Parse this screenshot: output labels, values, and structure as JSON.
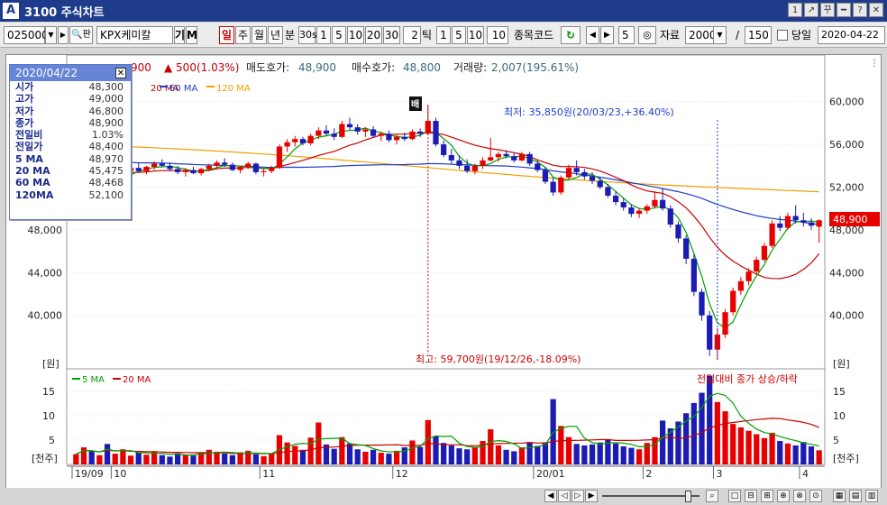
{
  "window": {
    "logo": "A",
    "title": "3100 주식차트",
    "buttons": [
      "1",
      "↗",
      "꾸",
      "━",
      "?",
      "✕"
    ]
  },
  "toolbar": {
    "stock_code": "025000",
    "search_label": "🔍",
    "search_suffix": "판",
    "stock_name": "KPX케미칼",
    "btn_gi": "기",
    "btn_m": "M",
    "period_tabs": [
      "일",
      "주",
      "월",
      "년",
      "분"
    ],
    "active_period": "일",
    "minute_options": [
      "30s",
      "1",
      "5",
      "10",
      "20",
      "30"
    ],
    "tick_value": "2",
    "tick_label": "틱",
    "tick_options": [
      "1",
      "5",
      "10"
    ],
    "tick_input": "10",
    "code_label": "종목코드",
    "count_value": "5",
    "data_label": "자료",
    "data_count": "2000",
    "separator": "/",
    "view_count": "150",
    "today_label": "당일",
    "date_value": "2020-04-22"
  },
  "chart_header": {
    "price_partial": "900",
    "change": "▲ 500(1.03%)",
    "ask_label": "매도호가:",
    "ask_value": "48,900",
    "bid_label": "매수호가:",
    "bid_value": "48,800",
    "volume_label": "거래량:",
    "volume_value": "2,007(195.61%)"
  },
  "legend": {
    "ma5": "5 MA",
    "ma20": "20 MA",
    "ma60": "60 MA",
    "ma120": "120 MA"
  },
  "colors": {
    "up": "#e60000",
    "down": "#1c1cb4",
    "ma5": "#00a000",
    "ma20": "#c80000",
    "ma60": "#1e3cc8",
    "ma120": "#f0a000",
    "title_bg": "#1f3c8c",
    "last_price_bg": "#e60000"
  },
  "info_box": {
    "date": "2020/04/22",
    "close_icon": "✕",
    "rows": [
      {
        "k": "시가",
        "v": "48,300"
      },
      {
        "k": "고가",
        "v": "49,000"
      },
      {
        "k": "저가",
        "v": "46,800"
      },
      {
        "k": "종가",
        "v": "48,900"
      },
      {
        "k": "전일비",
        "v": "1.03%"
      },
      {
        "k": "전일가",
        "v": "48,400"
      },
      {
        "k": "5  MA",
        "v": "48,970"
      },
      {
        "k": "20 MA",
        "v": "45,475"
      },
      {
        "k": "60 MA",
        "v": "48,468"
      },
      {
        "k": "120MA",
        "v": "52,100"
      }
    ]
  },
  "annotations": {
    "low": "최저: 35,850원(20/03/23,+36.40%)",
    "high": "최고: 59,700원(19/12/26,-18.09%)",
    "marker_label": "배",
    "volume_legend": "전일대비 종가 상승/하락",
    "last_price": "48,900"
  },
  "chart_data": {
    "type": "candlestick",
    "y_unit": "[원]",
    "volume_unit": "[천주]",
    "price_axis_ticks": [
      "60,000",
      "56,000",
      "52,000",
      "48,000",
      "44,000",
      "40,000"
    ],
    "price_axis_values": [
      60000,
      56000,
      52000,
      48000,
      44000,
      40000
    ],
    "volume_axis_ticks": [
      "15",
      "10",
      "5"
    ],
    "volume_axis_values": [
      15,
      10,
      5
    ],
    "x_labels": [
      "19/09",
      "10",
      "11",
      "12",
      "20/01",
      "2",
      "3",
      "4"
    ],
    "ylim": [
      35000,
      62000
    ],
    "candles": [
      [
        53500,
        54200,
        53000,
        53800
      ],
      [
        53800,
        54500,
        53400,
        54100
      ],
      [
        54100,
        54300,
        52800,
        53000
      ],
      [
        53000,
        53600,
        52500,
        53400
      ],
      [
        53400,
        53700,
        52000,
        52200
      ],
      [
        52200,
        53300,
        52000,
        53100
      ],
      [
        53100,
        53800,
        52800,
        53500
      ],
      [
        53500,
        54000,
        53100,
        53800
      ],
      [
        53800,
        54300,
        53400,
        53500
      ],
      [
        53500,
        54000,
        53200,
        53900
      ],
      [
        53900,
        54400,
        53600,
        54200
      ],
      [
        54200,
        54600,
        53900,
        54000
      ],
      [
        54000,
        54300,
        53500,
        53700
      ],
      [
        53700,
        54000,
        53200,
        53400
      ],
      [
        53400,
        53800,
        53000,
        53600
      ],
      [
        53600,
        53900,
        53200,
        53300
      ],
      [
        53300,
        53800,
        53100,
        53700
      ],
      [
        53700,
        54200,
        53500,
        54000
      ],
      [
        54000,
        54500,
        53700,
        54300
      ],
      [
        54300,
        54700,
        53900,
        54100
      ],
      [
        54100,
        54300,
        53500,
        53600
      ],
      [
        53600,
        54000,
        53300,
        53900
      ],
      [
        53900,
        54400,
        53700,
        54200
      ],
      [
        54200,
        54300,
        53200,
        53400
      ],
      [
        53400,
        53700,
        53000,
        53500
      ],
      [
        53500,
        54000,
        53300,
        53800
      ],
      [
        53800,
        56000,
        53700,
        55800
      ],
      [
        55800,
        56500,
        55300,
        56200
      ],
      [
        56200,
        56800,
        55800,
        56500
      ],
      [
        56500,
        56700,
        55900,
        56100
      ],
      [
        56100,
        57000,
        55900,
        56800
      ],
      [
        56800,
        57600,
        56500,
        57300
      ],
      [
        57300,
        57800,
        56800,
        57000
      ],
      [
        57000,
        57500,
        56400,
        56700
      ],
      [
        56700,
        58200,
        56600,
        57900
      ],
      [
        57900,
        58500,
        57300,
        57600
      ],
      [
        57600,
        57900,
        56900,
        57200
      ],
      [
        57200,
        57600,
        56700,
        57400
      ],
      [
        57400,
        57700,
        56600,
        56800
      ],
      [
        56800,
        57200,
        56300,
        57000
      ],
      [
        57000,
        57300,
        56200,
        56400
      ],
      [
        56400,
        56900,
        56000,
        56700
      ],
      [
        56700,
        57100,
        56300,
        56500
      ],
      [
        56500,
        57400,
        56400,
        57200
      ],
      [
        57200,
        57500,
        56700,
        57000
      ],
      [
        57000,
        59700,
        56900,
        58200
      ],
      [
        58200,
        58500,
        55800,
        56000
      ],
      [
        56000,
        56400,
        54800,
        55000
      ],
      [
        55000,
        55600,
        54200,
        54500
      ],
      [
        54500,
        55000,
        53700,
        54000
      ],
      [
        54000,
        54600,
        53300,
        53500
      ],
      [
        53500,
        54200,
        53200,
        54000
      ],
      [
        54000,
        54800,
        53700,
        54500
      ],
      [
        54500,
        56600,
        54400,
        54800
      ],
      [
        54800,
        55300,
        54400,
        55100
      ],
      [
        55100,
        55400,
        54700,
        54900
      ],
      [
        54900,
        55200,
        54300,
        54500
      ],
      [
        54500,
        55300,
        54400,
        55100
      ],
      [
        55100,
        55300,
        54000,
        54200
      ],
      [
        54200,
        54500,
        53400,
        53600
      ],
      [
        53600,
        53900,
        52300,
        52500
      ],
      [
        52500,
        52900,
        51200,
        51500
      ],
      [
        51500,
        53100,
        51300,
        52900
      ],
      [
        52900,
        54100,
        52700,
        53800
      ],
      [
        53800,
        54500,
        53100,
        53400
      ],
      [
        53400,
        53700,
        52700,
        53000
      ],
      [
        53000,
        53400,
        52300,
        52600
      ],
      [
        52600,
        52900,
        51800,
        52000
      ],
      [
        52000,
        52300,
        51000,
        51200
      ],
      [
        51200,
        51600,
        50300,
        50600
      ],
      [
        50600,
        51000,
        49800,
        50100
      ],
      [
        50100,
        50400,
        49200,
        49500
      ],
      [
        49500,
        50000,
        49100,
        49800
      ],
      [
        49800,
        50400,
        49500,
        50200
      ],
      [
        50200,
        51600,
        50000,
        50800
      ],
      [
        50800,
        51900,
        49800,
        50000
      ],
      [
        50000,
        50300,
        48200,
        48500
      ],
      [
        48500,
        48800,
        46800,
        47200
      ],
      [
        47200,
        47500,
        44800,
        45300
      ],
      [
        45300,
        45700,
        41800,
        42200
      ],
      [
        42200,
        42500,
        39500,
        40000
      ],
      [
        40000,
        40400,
        36200,
        36800
      ],
      [
        36800,
        38800,
        35850,
        38200
      ],
      [
        38200,
        40600,
        37900,
        40300
      ],
      [
        40300,
        42600,
        40000,
        42300
      ],
      [
        42300,
        43600,
        41900,
        43200
      ],
      [
        43200,
        44400,
        42800,
        44100
      ],
      [
        44100,
        45500,
        43800,
        45200
      ],
      [
        45200,
        46800,
        45000,
        46500
      ],
      [
        46500,
        48900,
        46300,
        48600
      ],
      [
        48600,
        49300,
        47900,
        48200
      ],
      [
        48200,
        49600,
        48000,
        49300
      ],
      [
        49300,
        50300,
        48600,
        48900
      ],
      [
        48900,
        49600,
        48300,
        48700
      ],
      [
        48700,
        49100,
        48000,
        48400
      ],
      [
        48300,
        49000,
        46800,
        48900
      ]
    ],
    "volumes": [
      2.1,
      3.5,
      2.8,
      1.9,
      4.2,
      2.2,
      3.1,
      1.8,
      2.5,
      2.0,
      2.7,
      1.9,
      1.6,
      2.3,
      2.0,
      1.8,
      2.4,
      3.0,
      2.6,
      2.2,
      1.9,
      2.5,
      2.8,
      2.1,
      1.7,
      2.3,
      6.0,
      4.5,
      3.8,
      3.0,
      5.5,
      8.6,
      4.1,
      3.2,
      5.6,
      4.3,
      3.1,
      2.6,
      3.0,
      2.4,
      2.2,
      2.8,
      3.5,
      4.9,
      3.6,
      9.1,
      5.8,
      4.4,
      3.9,
      3.3,
      3.1,
      3.6,
      4.8,
      7.2,
      3.9,
      3.0,
      2.7,
      3.5,
      4.6,
      3.8,
      4.4,
      13.4,
      7.9,
      5.6,
      4.2,
      3.9,
      4.1,
      4.5,
      5.0,
      4.3,
      3.7,
      3.4,
      3.1,
      4.4,
      5.6,
      9.0,
      7.4,
      8.8,
      10.5,
      12.6,
      14.7,
      18.2,
      12.8,
      10.9,
      8.3,
      7.6,
      6.9,
      6.2,
      5.4,
      6.5,
      4.8,
      4.3,
      3.9,
      4.6,
      3.7,
      2.9
    ],
    "volume_ylim": [
      0,
      18.5
    ]
  }
}
